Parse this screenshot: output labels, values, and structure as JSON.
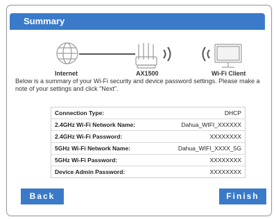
{
  "header": {
    "title": "Summary"
  },
  "diagram": {
    "internet_label": "Internet",
    "router_label": "AX1500",
    "client_label": "Wi-Fi Client"
  },
  "description": "Below is a summary of your Wi-Fi security and device password settings. Please make a note of your settings and click \"Next\".",
  "settings": [
    {
      "label": "Connection Type:",
      "value": "DHCP"
    },
    {
      "label": "2.4GHz Wi-Fi Network Name:",
      "value": "Dahua_WIFI_XXXXXX"
    },
    {
      "label": "2.4GHz Wi-Fi Password:",
      "value": "XXXXXXXX"
    },
    {
      "label": "5GHz Wi-Fi Network Name:",
      "value": "Dahua_WIFI_XXXX_5G"
    },
    {
      "label": "5GHz Wi-Fi Password:",
      "value": "XXXXXXXX"
    },
    {
      "label": "Device Admin Password:",
      "value": "XXXXXXXX"
    }
  ],
  "buttons": {
    "back": "Back",
    "finish": "Finish"
  },
  "colors": {
    "accent": "#3a7ac9",
    "border": "#9a9a9a"
  },
  "icons": [
    "globe-icon",
    "router-icon",
    "wifi-signal-icon",
    "monitor-icon"
  ]
}
